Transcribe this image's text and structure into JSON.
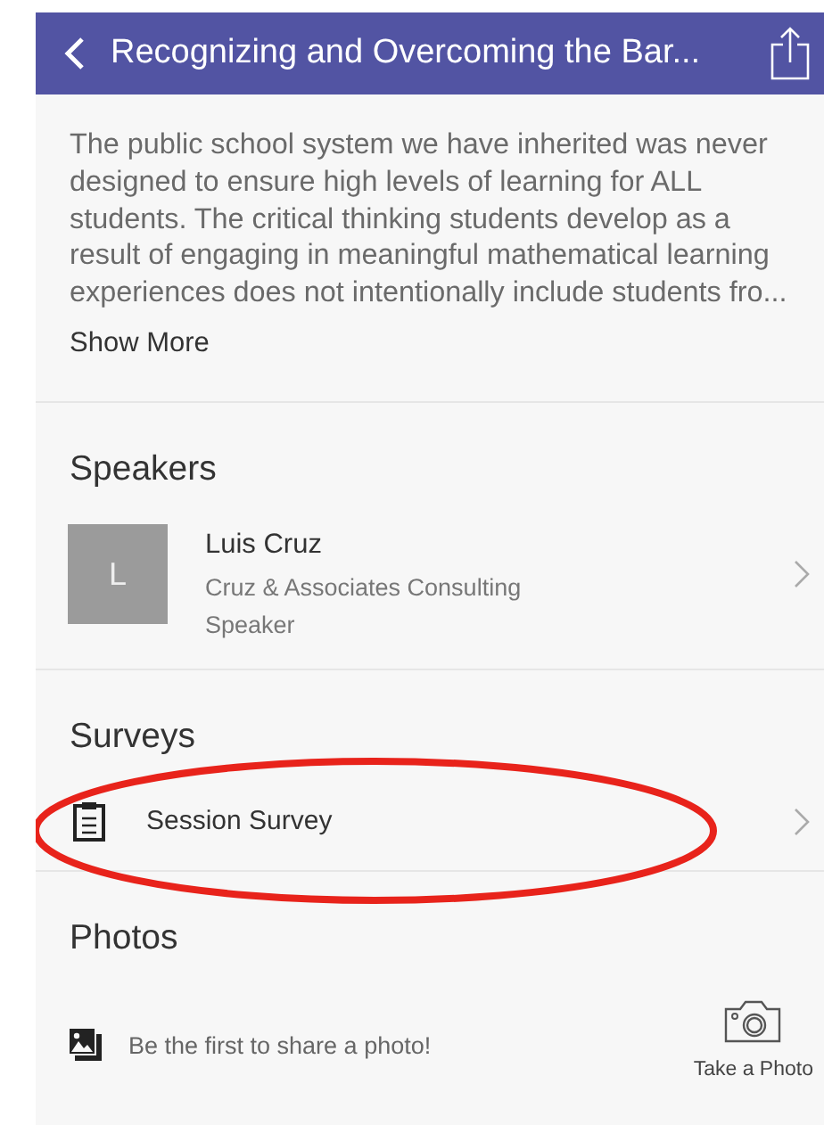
{
  "header": {
    "title": "Recognizing and Overcoming the Bar..."
  },
  "description": {
    "text": "The public school system we have inherited was never designed to ensure high levels of learning for ALL students. The critical thinking students develop as a result of engaging in meaningful mathematical learning experiences does not intentionally include students fro...",
    "more": "Show More"
  },
  "sections": [
    {
      "kind": "speakers",
      "title": "Speakers",
      "items": [
        {
          "initial": "L",
          "name": "Luis Cruz",
          "company": "Cruz & Associates Consulting",
          "role": "Speaker"
        }
      ]
    },
    {
      "kind": "surveys",
      "title": "Surveys",
      "items": [
        {
          "label": "Session Survey",
          "circled": true
        }
      ]
    },
    {
      "kind": "photos",
      "title": "Photos",
      "empty_text": "Be the first to share a photo!",
      "action": "Take a Photo"
    }
  ]
}
